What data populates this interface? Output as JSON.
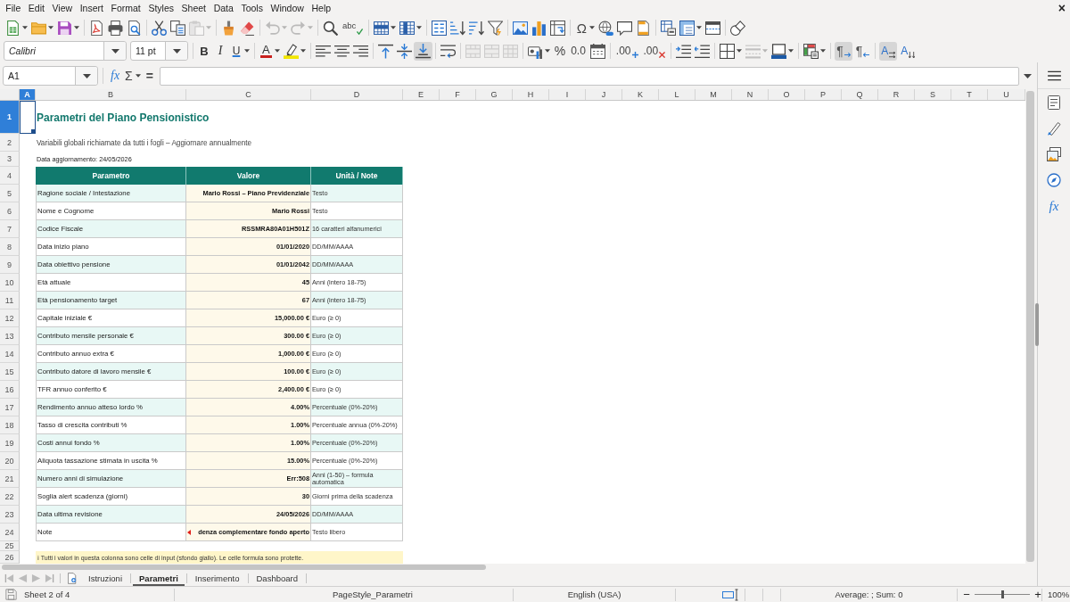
{
  "menu": [
    "File",
    "Edit",
    "View",
    "Insert",
    "Format",
    "Styles",
    "Sheet",
    "Data",
    "Tools",
    "Window",
    "Help"
  ],
  "document_close": "×",
  "standard_toolbar": [
    {
      "disabled": false
    },
    {
      "disabled": false
    },
    {
      "disabled": false
    },
    {
      "disabled": false
    },
    {
      "disabled": false
    },
    {
      "disabled": false
    },
    {
      "disabled": false
    },
    {
      "disabled": false
    },
    {
      "disabled": true
    },
    {
      "disabled": false
    },
    {
      "disabled": false
    },
    {
      "disabled": true
    },
    {
      "disabled": true
    },
    {
      "disabled": false
    },
    {
      "glyph": "abc",
      "disabled": false
    },
    {
      "disabled": false
    },
    {
      "disabled": false
    },
    {
      "disabled": false
    },
    {
      "disabled": false
    },
    {
      "disabled": false
    },
    {
      "disabled": false
    },
    {
      "disabled": false
    },
    {
      "disabled": false
    },
    {
      "disabled": false
    },
    {
      "glyph": "Ω",
      "disabled": false
    },
    {
      "disabled": false
    },
    {
      "disabled": false
    },
    {
      "disabled": false
    },
    {
      "disabled": false
    },
    {
      "disabled": false
    },
    {
      "disabled": false
    },
    {
      "disabled": false
    }
  ],
  "format_toolbar": {
    "font_name": "Calibri",
    "font_size": "11 pt",
    "buttons": [
      {
        "glyph": "B",
        "disabled": false,
        "selected": false
      },
      {
        "glyph": "I",
        "disabled": false,
        "selected": false
      },
      {
        "glyph": "U",
        "disabled": false,
        "selected": false
      },
      {
        "glyph": "A",
        "disabled": false,
        "selected": false
      },
      {
        "disabled": false,
        "selected": false
      },
      {
        "disabled": false,
        "selected": false
      },
      {
        "disabled": false,
        "selected": false
      },
      {
        "disabled": false,
        "selected": false
      },
      {
        "disabled": false,
        "selected": false
      },
      {
        "disabled": false,
        "selected": false
      },
      {
        "disabled": false,
        "selected": true
      },
      {
        "disabled": false,
        "selected": false
      },
      {
        "disabled": true,
        "selected": false
      },
      {
        "disabled": true,
        "selected": false
      },
      {
        "disabled": true,
        "selected": false
      },
      {
        "disabled": false,
        "selected": false
      },
      {
        "glyph": "%",
        "disabled": false,
        "selected": false
      },
      {
        "glyph": "0.0",
        "disabled": false,
        "selected": false
      },
      {
        "disabled": false,
        "selected": false
      },
      {
        "glyph": ".00",
        "disabled": false,
        "selected": false
      },
      {
        "glyph": ".00",
        "disabled": false,
        "selected": false
      },
      {
        "disabled": false,
        "selected": false
      },
      {
        "disabled": false,
        "selected": false
      },
      {
        "disabled": false,
        "selected": false
      },
      {
        "disabled": true,
        "selected": false
      },
      {
        "disabled": false,
        "selected": false
      },
      {
        "disabled": false,
        "selected": false
      },
      {
        "glyph": "¶",
        "disabled": false,
        "selected": true
      },
      {
        "glyph": "¶",
        "disabled": false,
        "selected": false
      },
      {
        "glyph": "A",
        "disabled": false,
        "selected": true
      },
      {
        "glyph": "A",
        "disabled": false,
        "selected": false
      }
    ]
  },
  "formula_bar": {
    "cell_reference": "A1",
    "function_wizard": "fx",
    "sum": "Σ",
    "equals": "="
  },
  "column_headers": [
    {
      "label": "A",
      "selected": true
    },
    {
      "label": "B",
      "selected": false
    },
    {
      "label": "C",
      "selected": false
    },
    {
      "label": "D",
      "selected": false
    },
    {
      "label": "E",
      "selected": false
    },
    {
      "label": "F",
      "selected": false
    },
    {
      "label": "G",
      "selected": false
    },
    {
      "label": "H",
      "selected": false
    },
    {
      "label": "I",
      "selected": false
    },
    {
      "label": "J",
      "selected": false
    },
    {
      "label": "K",
      "selected": false
    },
    {
      "label": "L",
      "selected": false
    },
    {
      "label": "M",
      "selected": false
    },
    {
      "label": "N",
      "selected": false
    },
    {
      "label": "O",
      "selected": false
    },
    {
      "label": "P",
      "selected": false
    },
    {
      "label": "Q",
      "selected": false
    },
    {
      "label": "R",
      "selected": false
    },
    {
      "label": "S",
      "selected": false
    },
    {
      "label": "T",
      "selected": false
    },
    {
      "label": "U",
      "selected": false
    }
  ],
  "row_headers": [
    {
      "label": "1",
      "selected": true
    },
    {
      "label": "2",
      "selected": false
    },
    {
      "label": "3",
      "selected": false
    },
    {
      "label": "4",
      "selected": false
    },
    {
      "label": "5",
      "selected": false
    },
    {
      "label": "6",
      "selected": false
    },
    {
      "label": "7",
      "selected": false
    },
    {
      "label": "8",
      "selected": false
    },
    {
      "label": "9",
      "selected": false
    },
    {
      "label": "10",
      "selected": false
    },
    {
      "label": "11",
      "selected": false
    },
    {
      "label": "12",
      "selected": false
    },
    {
      "label": "13",
      "selected": false
    },
    {
      "label": "14",
      "selected": false
    },
    {
      "label": "15",
      "selected": false
    },
    {
      "label": "16",
      "selected": false
    },
    {
      "label": "17",
      "selected": false
    },
    {
      "label": "18",
      "selected": false
    },
    {
      "label": "19",
      "selected": false
    },
    {
      "label": "20",
      "selected": false
    },
    {
      "label": "21",
      "selected": false
    },
    {
      "label": "22",
      "selected": false
    },
    {
      "label": "23",
      "selected": false
    },
    {
      "label": "24",
      "selected": false
    },
    {
      "label": "25",
      "selected": false
    },
    {
      "label": "26",
      "selected": false
    }
  ],
  "sheet": {
    "title": "Parametri del Piano Pensionistico",
    "subtitle": "Variabili globali richiamate da tutti i fogli – Aggiornare annualmente",
    "update_line": "Data aggiornamento: 24/05/2026",
    "table": {
      "columns": [
        "Parametro",
        "Valore",
        "Unità / Note"
      ],
      "rows": [
        {
          "parameter": "Ragione sociale / Intestazione",
          "value": "Mario Rossi – Piano Previdenziale",
          "note": "Testo",
          "overflow": false
        },
        {
          "parameter": "Nome e Cognome",
          "value": "Mario Rossi",
          "note": "Testo",
          "overflow": false
        },
        {
          "parameter": "Codice Fiscale",
          "value": "RSSMRA80A01H501Z",
          "note": "16 caratteri alfanumerici",
          "overflow": false
        },
        {
          "parameter": "Data inizio piano",
          "value": "01/01/2020",
          "note": "DD/MM/AAAA",
          "overflow": false
        },
        {
          "parameter": "Data obiettivo pensione",
          "value": "01/01/2042",
          "note": "DD/MM/AAAA",
          "overflow": false
        },
        {
          "parameter": "Età attuale",
          "value": "45",
          "note": "Anni (intero 18-75)",
          "overflow": false
        },
        {
          "parameter": "Età pensionamento target",
          "value": "67",
          "note": "Anni (intero 18-75)",
          "overflow": false
        },
        {
          "parameter": "Capitale iniziale €",
          "value": "15,000.00 €",
          "note": "Euro (≥ 0)",
          "overflow": false
        },
        {
          "parameter": "Contributo mensile personale €",
          "value": "300.00 €",
          "note": "Euro (≥ 0)",
          "overflow": false
        },
        {
          "parameter": "Contributo annuo extra €",
          "value": "1,000.00 €",
          "note": "Euro (≥ 0)",
          "overflow": false
        },
        {
          "parameter": "Contributo datore di lavoro mensile €",
          "value": "100.00 €",
          "note": "Euro (≥ 0)",
          "overflow": false
        },
        {
          "parameter": "TFR annuo conferito €",
          "value": "2,400.00 €",
          "note": "Euro (≥ 0)",
          "overflow": false
        },
        {
          "parameter": "Rendimento annuo atteso lordo %",
          "value": "4.00%",
          "note": "Percentuale (0%-20%)",
          "overflow": false
        },
        {
          "parameter": "Tasso di crescita contributi %",
          "value": "1.00%",
          "note": "Percentuale annua (0%-20%)",
          "overflow": false
        },
        {
          "parameter": "Costi annui fondo %",
          "value": "1.00%",
          "note": "Percentuale (0%-20%)",
          "overflow": false
        },
        {
          "parameter": "Aliquota tassazione stimata in uscita %",
          "value": "15.00%",
          "note": "Percentuale (0%-20%)",
          "overflow": false
        },
        {
          "parameter": "Numero anni di simulazione",
          "value": "Err:508",
          "note": "Anni (1-50) – formula automatica",
          "overflow": false
        },
        {
          "parameter": "Soglia alert scadenza (giorni)",
          "value": "30",
          "note": "Giorni prima della scadenza",
          "overflow": false
        },
        {
          "parameter": "Data ultima revisione",
          "value": "24/05/2026",
          "note": "DD/MM/AAAA",
          "overflow": false
        },
        {
          "parameter": "Note",
          "value": "denza complementare fondo aperto",
          "note": "Testo libero",
          "overflow": true
        }
      ]
    },
    "info_note": "ℹ Tutti i valori in questa colonna sono celle di input (sfondo giallo). Le celle formula sono protette."
  },
  "sheet_tabs": [
    {
      "label": "Istruzioni",
      "selected": false
    },
    {
      "label": "Parametri",
      "selected": true
    },
    {
      "label": "Inserimento",
      "selected": false
    },
    {
      "label": "Dashboard",
      "selected": false
    }
  ],
  "sidebar": {
    "functions": "fx"
  },
  "status_bar": {
    "sheet_position": "Sheet 2 of 4",
    "page_style": "PageStyle_Parametri",
    "language": "English (USA)",
    "selection_summary": "Average: ; Sum: 0",
    "zoom_out": "−",
    "zoom": {
      "level": 0.5
    },
    "zoom_in": "+",
    "zoom_reading": "100%"
  }
}
